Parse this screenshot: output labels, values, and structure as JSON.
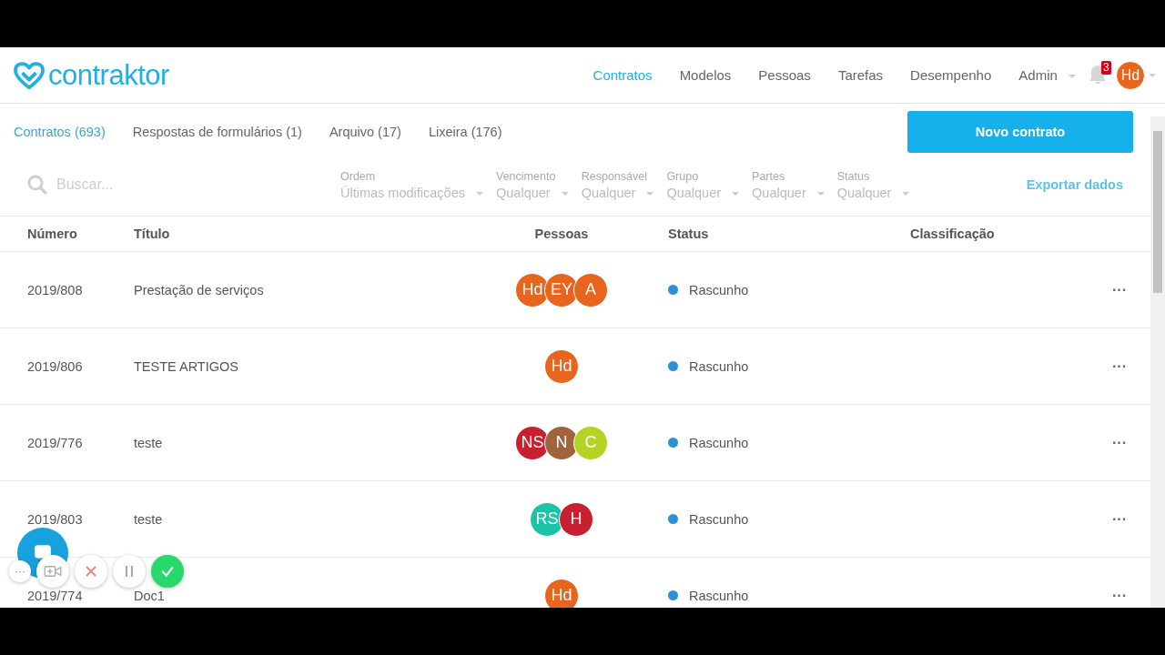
{
  "brand": "contraktor",
  "nav": [
    {
      "label": "Contratos",
      "selected": true
    },
    {
      "label": "Modelos",
      "selected": false
    },
    {
      "label": "Pessoas",
      "selected": false
    },
    {
      "label": "Tarefas",
      "selected": false
    },
    {
      "label": "Desempenho",
      "selected": false
    }
  ],
  "admin": "Admin",
  "notifications": "3",
  "user": {
    "initials": "Hd",
    "color": "#e8651e"
  },
  "tabs": [
    {
      "label": "Contratos (693)",
      "selected": true
    },
    {
      "label": "Respostas de formulários (1)",
      "selected": false
    },
    {
      "label": "Arquivo (17)",
      "selected": false
    },
    {
      "label": "Lixeira (176)",
      "selected": false
    }
  ],
  "new_button": "Novo contrato",
  "search": {
    "placeholder": "Buscar..."
  },
  "filters": [
    {
      "label": "Ordem",
      "value": "Últimas modificações"
    },
    {
      "label": "Vencimento",
      "value": "Qualquer"
    },
    {
      "label": "Responsável",
      "value": "Qualquer"
    },
    {
      "label": "Grupo",
      "value": "Qualquer"
    },
    {
      "label": "Partes",
      "value": "Qualquer"
    },
    {
      "label": "Status",
      "value": "Qualquer"
    }
  ],
  "export": "Exportar dados",
  "table": {
    "columns": [
      "Número",
      "Título",
      "Pessoas",
      "Status",
      "Classificação"
    ],
    "rows": [
      {
        "number": "2019/808",
        "title": "Prestação de serviços",
        "people": [
          {
            "initials": "Hd",
            "color": "#e8651e"
          },
          {
            "initials": "EY",
            "color": "#e8651e"
          },
          {
            "initials": "A",
            "color": "#e8651e"
          }
        ],
        "status": "Rascunho",
        "actions": "···"
      },
      {
        "number": "2019/806",
        "title": "TESTE ARTIGOS",
        "people": [
          {
            "initials": "Hd",
            "color": "#e8651e"
          }
        ],
        "status": "Rascunho",
        "actions": "···"
      },
      {
        "number": "2019/776",
        "title": "teste",
        "people": [
          {
            "initials": "NS",
            "color": "#c8202f"
          },
          {
            "initials": "N",
            "color": "#a0643c"
          },
          {
            "initials": "C",
            "color": "#b5d225"
          }
        ],
        "status": "Rascunho",
        "actions": "···"
      },
      {
        "number": "2019/803",
        "title": "teste",
        "people": [
          {
            "initials": "RS",
            "color": "#1bc4a7"
          },
          {
            "initials": "H",
            "color": "#c8202f"
          }
        ],
        "status": "Rascunho",
        "actions": "···"
      },
      {
        "number": "2019/774",
        "title": "Doc1",
        "people": [
          {
            "initials": "Hd",
            "color": "#e8651e"
          }
        ],
        "status": "Rascunho",
        "actions": "···"
      }
    ]
  },
  "recorder": {
    "more": "···"
  }
}
